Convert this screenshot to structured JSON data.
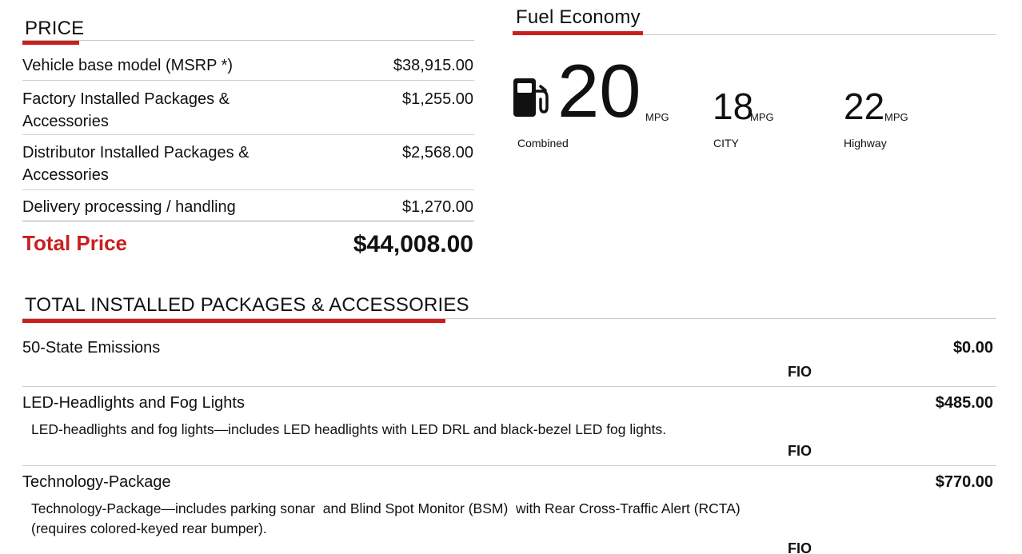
{
  "price": {
    "heading": "PRICE",
    "rows": [
      {
        "label": "Vehicle base model (MSRP *)",
        "value": "$38,915.00"
      },
      {
        "label": "Factory Installed Packages & Accessories",
        "value": "$1,255.00"
      },
      {
        "label": "Distributor Installed Packages & Accessories",
        "value": "$2,568.00"
      },
      {
        "label": "Delivery processing / handling",
        "value": "$1,270.00"
      }
    ],
    "total_label": "Total Price",
    "total_value": "$44,008.00"
  },
  "fuel": {
    "heading": "Fuel Economy",
    "icon": "fuel-pump-icon",
    "combined": {
      "value": "20",
      "unit": "MPG",
      "caption": "Combined"
    },
    "city": {
      "value": "18",
      "unit": "MPG",
      "caption": "CITY"
    },
    "highway": {
      "value": "22",
      "unit": "MPG",
      "caption": "Highway"
    }
  },
  "packages": {
    "heading": "TOTAL INSTALLED PACKAGES & ACCESSORIES",
    "items": [
      {
        "title": "50-State Emissions",
        "price": "$0.00",
        "description": "",
        "tag": "FIO"
      },
      {
        "title": "LED-Headlights and Fog Lights",
        "price": "$485.00",
        "description": "LED-headlights and fog lights—includes LED headlights with LED DRL and black-bezel LED fog lights.",
        "tag": "FIO"
      },
      {
        "title": "Technology-Package",
        "price": "$770.00",
        "description_line1": "Technology-Package—includes parking sonar  and Blind Spot Monitor (BSM)  with Rear Cross-Traffic Alert (RCTA)",
        "description_line2": "(requires colored-keyed rear bumper).",
        "tag": "FIO"
      }
    ]
  },
  "colors": {
    "accent": "#c8201e",
    "rule": "#c8c8c8",
    "text": "#111111"
  }
}
